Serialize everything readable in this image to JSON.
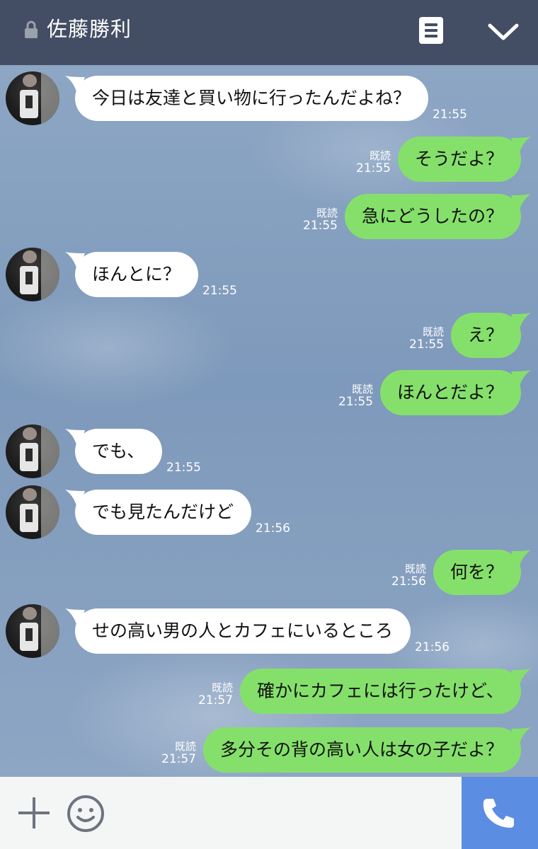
{
  "header": {
    "title": "佐藤勝利",
    "icons": [
      "lock-icon",
      "menu-icon",
      "chevron-down-icon"
    ]
  },
  "messages": [
    {
      "side": "in",
      "text": "今日は友達と買い物に行ったんだよね？",
      "time": "21:55"
    },
    {
      "side": "out",
      "text": "そうだよ？",
      "read": "既読",
      "time": "21:55"
    },
    {
      "side": "out",
      "text": "急にどうしたの？",
      "read": "既読",
      "time": "21:55"
    },
    {
      "side": "in",
      "text": "ほんとに？",
      "time": "21:55"
    },
    {
      "side": "out",
      "text": "え？",
      "read": "既読",
      "time": "21:55"
    },
    {
      "side": "out",
      "text": "ほんとだよ？",
      "read": "既読",
      "time": "21:55"
    },
    {
      "side": "in",
      "text": "でも、",
      "time": "21:55"
    },
    {
      "side": "in",
      "text": "でも見たんだけど",
      "time": "21:56"
    },
    {
      "side": "out",
      "text": "何を？",
      "read": "既読",
      "time": "21:56"
    },
    {
      "side": "in",
      "text": "せの高い男の人とカフェにいるところ",
      "time": "21:56"
    },
    {
      "side": "out",
      "text": "確かにカフェには行ったけど、",
      "read": "既読",
      "time": "21:57"
    },
    {
      "side": "out",
      "text": "多分その背の高い人は女の子だよ？",
      "read": "既読",
      "time": "21:57"
    }
  ],
  "input_bar": {
    "icons": [
      "plus-icon",
      "smile-icon",
      "phone-icon"
    ]
  },
  "colors": {
    "header_bg": "#434d63",
    "outgoing_bubble": "#85e06b",
    "incoming_bubble": "#ffffff",
    "call_button": "#5b8ee2",
    "chat_bg": "#8aa3c2"
  }
}
